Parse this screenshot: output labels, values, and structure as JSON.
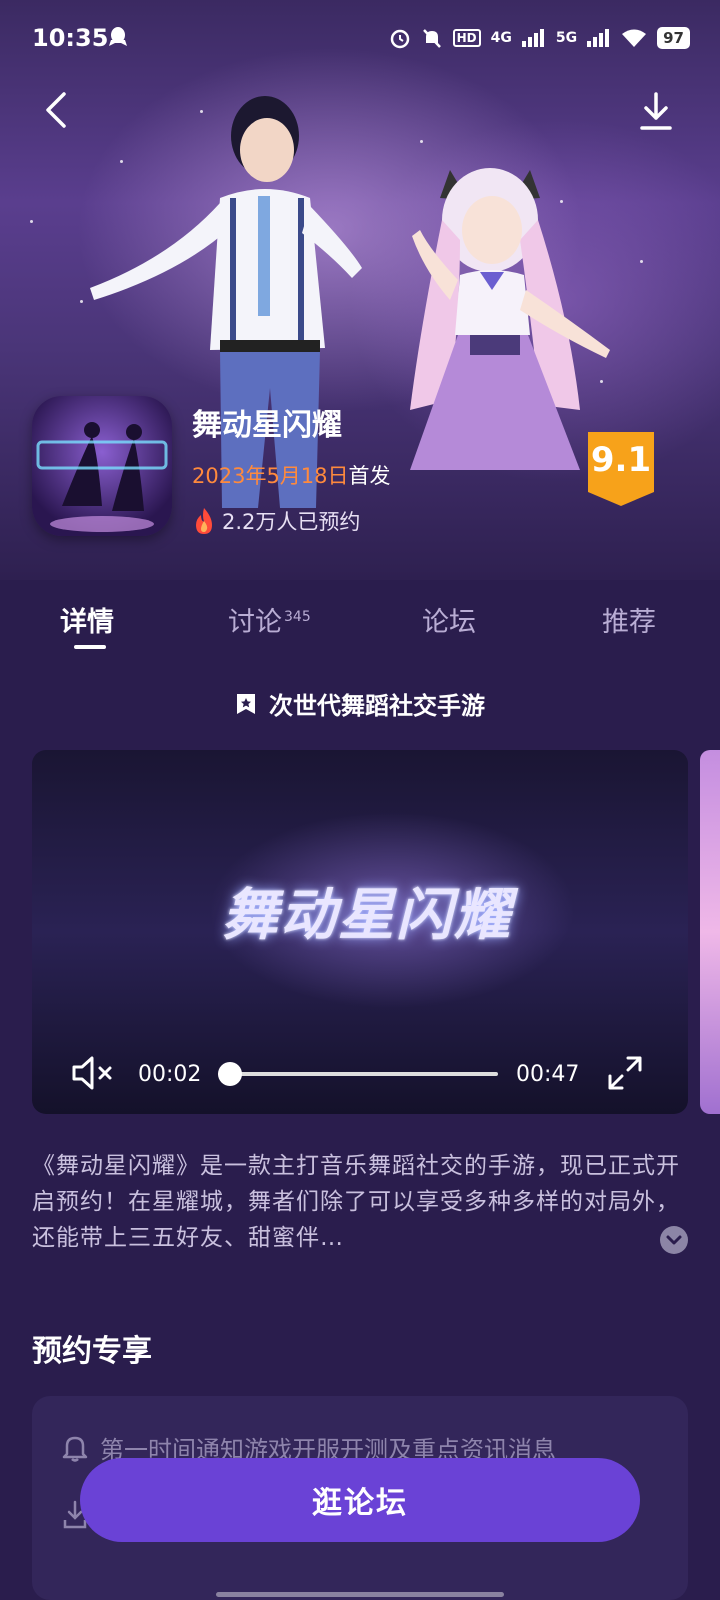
{
  "status_bar": {
    "time": "10:35",
    "network_1": "4G",
    "network_2": "5G",
    "hd_label": "HD",
    "battery": "97"
  },
  "nav": {
    "back_icon": "chevron-left-icon",
    "download_icon": "download-icon"
  },
  "app": {
    "name": "舞动星闪耀",
    "release_date": "2023年5月18日",
    "release_suffix": "首发",
    "reservations": "2.2万人已预约",
    "score": "9.1"
  },
  "tabs": [
    {
      "label": "详情",
      "active": true
    },
    {
      "label": "讨论",
      "badge": "345"
    },
    {
      "label": "论坛"
    },
    {
      "label": "推荐"
    }
  ],
  "tagline": "次世代舞蹈社交手游",
  "video": {
    "logo_text": "舞动星闪耀",
    "current_time": "00:02",
    "duration": "00:47",
    "progress_fraction": 0.043
  },
  "description": "《舞动星闪耀》是一款主打音乐舞蹈社交的手游，现已正式开启预约！在星耀城，舞者们除了可以享受多种多样的对局外，还能带上三五好友、甜蜜伴…",
  "reserve_perks": {
    "title": "预约专享",
    "items": [
      "第一时间通知游戏开服开测及重点资讯消息"
    ]
  },
  "cta": {
    "label": "逛论坛"
  },
  "colors": {
    "accent": "#6a42d6",
    "date_orange": "#ff8a3d",
    "score_badge": "#f7a21a",
    "background": "#2a1d4d"
  }
}
